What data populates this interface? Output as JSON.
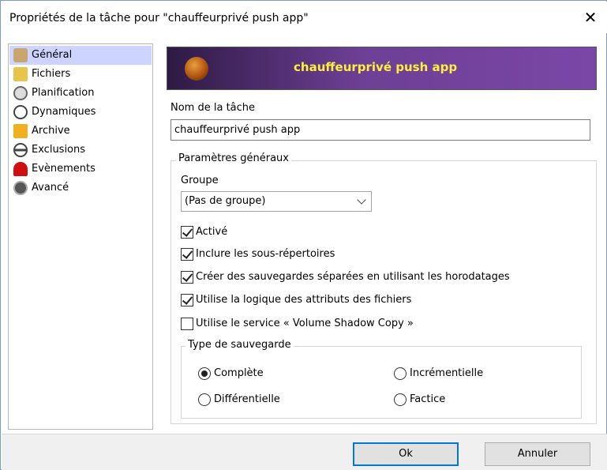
{
  "window": {
    "title": "Propriétés de la tâche pour \"chauffeurprivé push app\"",
    "close_glyph": "✕"
  },
  "sidebar": {
    "items": [
      {
        "label": "Général",
        "icon": "user-icon",
        "selected": true
      },
      {
        "label": "Fichiers",
        "icon": "files-icon"
      },
      {
        "label": "Planification",
        "icon": "clock-icon"
      },
      {
        "label": "Dynamiques",
        "icon": "refresh-icon"
      },
      {
        "label": "Archive",
        "icon": "archive-icon"
      },
      {
        "label": "Exclusions",
        "icon": "minus-circle-icon"
      },
      {
        "label": "Evènements",
        "icon": "magnet-icon"
      },
      {
        "label": "Avancé",
        "icon": "gear-icon"
      }
    ]
  },
  "banner": {
    "title": "chauffeurprivé push app"
  },
  "task": {
    "name_label": "Nom de la tâche",
    "name_value": "chauffeurprivé push app"
  },
  "general": {
    "legend": "Paramètres généraux",
    "group_label": "Groupe",
    "group_value": "(Pas de groupe)",
    "options": [
      {
        "label": "Activé",
        "checked": true
      },
      {
        "label": "Inclure les sous-répertoires",
        "checked": true
      },
      {
        "label": "Créer des sauvegardes séparées en utilisant les horodatages",
        "checked": true
      },
      {
        "label": "Utilise la logique des attributs des fichiers",
        "checked": true
      },
      {
        "label": "Utilise le service « Volume Shadow Copy »",
        "checked": false
      }
    ]
  },
  "backup_type": {
    "legend": "Type de sauvegarde",
    "options": [
      {
        "label": "Complète",
        "selected": true
      },
      {
        "label": "Incrémentielle",
        "selected": false
      },
      {
        "label": "Différentielle",
        "selected": false
      },
      {
        "label": "Factice",
        "selected": false
      }
    ]
  },
  "buttons": {
    "ok": "Ok",
    "cancel": "Annuler"
  },
  "colors": {
    "banner_text": "#ffef3f",
    "selection": "#ccd4ff",
    "default_border": "#0078d7"
  }
}
